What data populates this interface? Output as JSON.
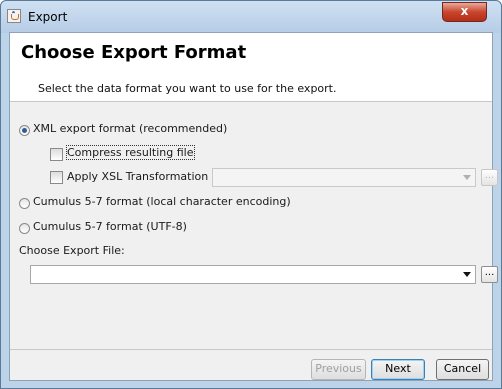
{
  "window": {
    "title": "Export",
    "close_glyph": "x"
  },
  "header": {
    "title": "Choose Export Format",
    "description": "Select the data format you want to use for the export."
  },
  "options": {
    "xml": "XML export format (recommended)",
    "compress": "Compress resulting file",
    "apply_xsl": "Apply XSL Transformation",
    "cumulus_local": "Cumulus 5-7 format (local character encoding)",
    "cumulus_utf8": "Cumulus 5-7 format (UTF-8)"
  },
  "state": {
    "selected_format": "xml",
    "compress_checked": false,
    "apply_xsl_checked": false
  },
  "xsl": {
    "value": "",
    "browse_label": "..."
  },
  "export_file": {
    "label": "Choose Export File:",
    "value": "",
    "browse_label": "..."
  },
  "buttons": {
    "previous": "Previous",
    "next": "Next",
    "cancel": "Cancel"
  },
  "colors": {
    "title_bar": "#bcd3ea",
    "close_button": "#c9452e",
    "content_bg": "#f0f0f0",
    "default_button_border": "#3c7fb1"
  },
  "icons": {
    "app": "java-app-icon",
    "close": "close-icon",
    "radio": "radio-button",
    "checkbox": "checkbox",
    "dropdown": "chevron-down-icon"
  }
}
